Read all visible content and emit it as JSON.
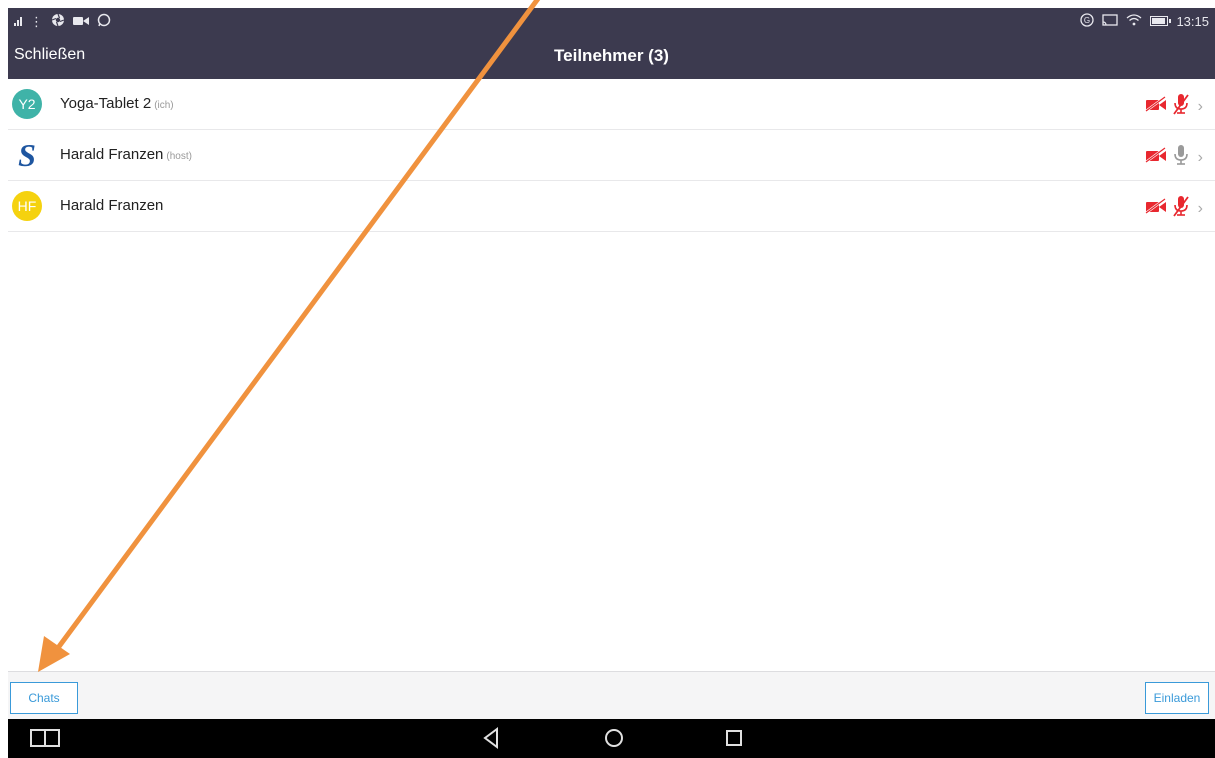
{
  "status_bar": {
    "time": "13:15"
  },
  "header": {
    "close_label": "Schließen",
    "title": "Teilnehmer (3)"
  },
  "participants": [
    {
      "initials": "Y2",
      "name": "Yoga-Tablet 2",
      "role": "(ich)",
      "avatar_color": "#3fb3a8",
      "video": "off",
      "audio": "muted"
    },
    {
      "initials": "S",
      "name": "Harald Franzen",
      "role": "(host)",
      "avatar_color": "#1e56a0",
      "video": "off",
      "audio": "unmuted"
    },
    {
      "initials": "HF",
      "name": "Harald Franzen",
      "role": "",
      "avatar_color": "#f5d20f",
      "video": "off",
      "audio": "muted"
    }
  ],
  "bottom_bar": {
    "chats_label": "Chats",
    "invite_label": "Einladen"
  },
  "colors": {
    "header_bg": "#3c3a4f",
    "accent": "#3a9ad9",
    "muted_red": "#e8282f",
    "annotation_arrow": "#f0923e"
  }
}
